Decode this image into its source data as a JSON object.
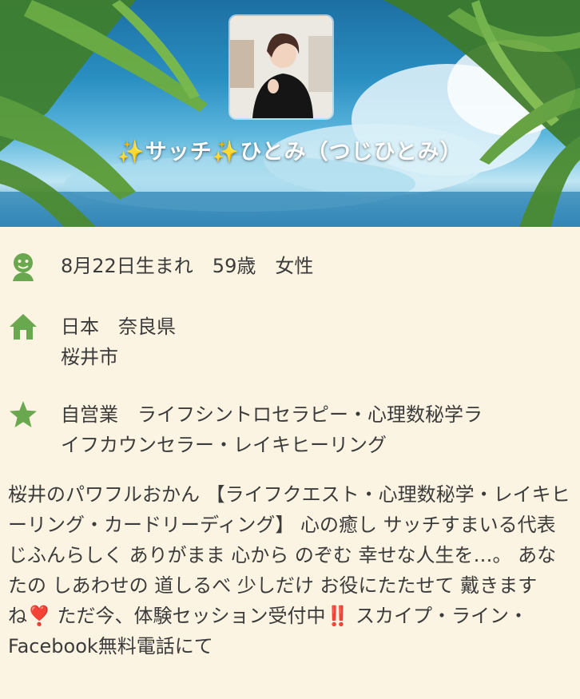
{
  "profile": {
    "name": "✨サッチ✨ひとみ（つじひとみ）",
    "birth_info": "8月22日生まれ　59歳　女性",
    "location_line1": "日本　奈良県",
    "location_line2": "桜井市",
    "occupation_line1": "自営業　ライフシントロセラピー・心理数秘学ラ",
    "occupation_line2": "イフカウンセラー・レイキヒーリング",
    "bio": "桜井のパワフルおかん 【ライフクエスト・心理数秘学・レイキヒーリング・カードリーディング】 心の癒し サッチすまいる代表 じふんらしく ありがまま 心から のぞむ 幸せな人生を…。 あなたの しあわせの 道しるべ 少しだけ お役にたたせて 戴きますね❣️ ただ今、体験セッション受付中‼️ スカイプ・ライン・Facebook無料電話にて"
  },
  "icons": {
    "birth": "person-icon",
    "location": "home-icon",
    "occupation": "star-icon"
  },
  "colors": {
    "background": "#fcf4e2",
    "icon_green": "#6aa84f",
    "text": "#3b3b3b"
  }
}
